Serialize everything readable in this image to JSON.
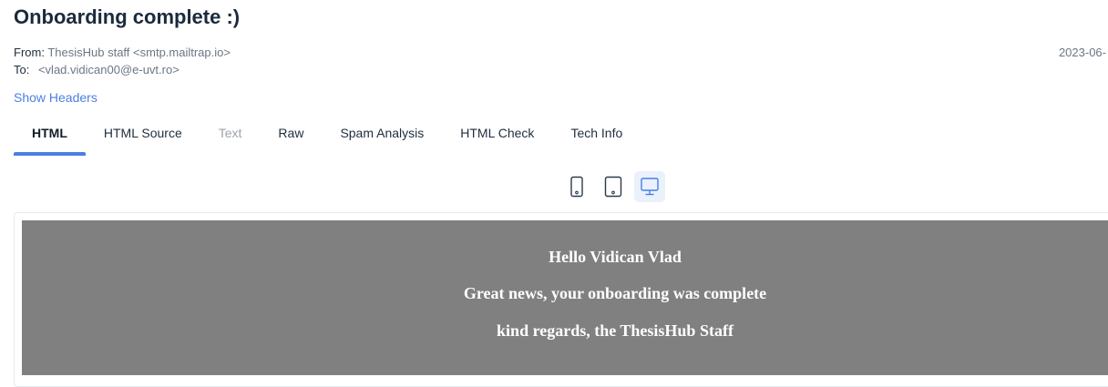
{
  "message": {
    "subject": "Onboarding complete :)",
    "from_label": "From:",
    "from_value": "ThesisHub staff <smtp.mailtrap.io>",
    "to_label": "To:",
    "to_value": "<vlad.vidican00@e-uvt.ro>",
    "date": "2023-06-",
    "show_headers": "Show Headers"
  },
  "tabs": [
    {
      "label": "HTML",
      "state": "active"
    },
    {
      "label": "HTML Source",
      "state": "normal"
    },
    {
      "label": "Text",
      "state": "disabled"
    },
    {
      "label": "Raw",
      "state": "normal"
    },
    {
      "label": "Spam Analysis",
      "state": "normal"
    },
    {
      "label": "HTML Check",
      "state": "normal"
    },
    {
      "label": "Tech Info",
      "state": "normal"
    }
  ],
  "device_toggle": {
    "options": [
      "mobile",
      "tablet",
      "desktop"
    ],
    "selected": "desktop",
    "icons": [
      "phone-icon",
      "tablet-icon",
      "desktop-icon"
    ],
    "accent_color": "#4a7fe3"
  },
  "email_body": {
    "background": "#808080",
    "lines": [
      "Hello Vidican Vlad",
      "Great news, your onboarding was complete",
      "kind regards, the ThesisHub Staff"
    ]
  }
}
